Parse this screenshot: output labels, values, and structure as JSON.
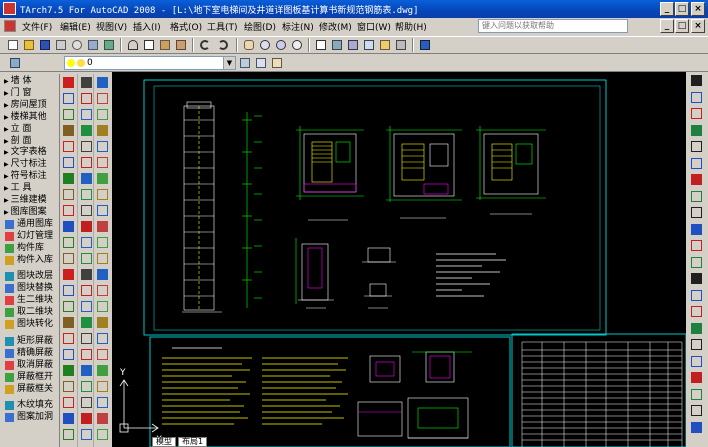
{
  "window": {
    "title": "TArch7.5 For AutoCAD 2008 - [L:\\地下室电梯间及井道详图板基计算书新规范钢筋表.dwg]",
    "buttons": [
      "_",
      "□",
      "×"
    ],
    "inner_buttons": [
      "_",
      "□",
      "×"
    ]
  },
  "menu": {
    "items": [
      "文件(F)",
      "编辑(E)",
      "视图(V)",
      "插入(I)",
      "格式(O)",
      "工具(T)",
      "绘图(D)",
      "标注(N)",
      "修改(M)",
      "窗口(W)",
      "帮助(H)"
    ],
    "help_placeholder": "键入问题以获取帮助"
  },
  "layer": {
    "current": "0"
  },
  "palette": {
    "items": [
      {
        "label": "墙  体",
        "style": "tri"
      },
      {
        "label": "门  窗",
        "style": "tri"
      },
      {
        "label": "房间屋顶",
        "style": "tri"
      },
      {
        "label": "楼梯其他",
        "style": "tri"
      },
      {
        "label": "立  面",
        "style": "tri"
      },
      {
        "label": "剖  面",
        "style": "tri"
      },
      {
        "label": "文字表格",
        "style": "tri"
      },
      {
        "label": "尺寸标注",
        "style": "tri"
      },
      {
        "label": "符号标注",
        "style": "tri"
      },
      {
        "label": "工  具",
        "style": "tri"
      },
      {
        "label": "三维建模",
        "style": "tri"
      },
      {
        "label": "图库图案",
        "style": "tri"
      },
      {
        "label": "通用图库",
        "style": "ico"
      },
      {
        "label": "幻灯管理",
        "style": "ico"
      },
      {
        "label": "构件库",
        "style": "ico"
      },
      {
        "label": "构件入库",
        "style": "ico"
      },
      {
        "label": "",
        "style": "gap"
      },
      {
        "label": "图块改层",
        "style": "ico"
      },
      {
        "label": "图块替换",
        "style": "ico"
      },
      {
        "label": "生二维块",
        "style": "ico"
      },
      {
        "label": "取二维块",
        "style": "ico"
      },
      {
        "label": "图块转化",
        "style": "ico"
      },
      {
        "label": "",
        "style": "gap"
      },
      {
        "label": "矩形屏蔽",
        "style": "ico"
      },
      {
        "label": "精确屏蔽",
        "style": "ico"
      },
      {
        "label": "取消屏蔽",
        "style": "ico"
      },
      {
        "label": "屏蔽框开",
        "style": "ico"
      },
      {
        "label": "屏蔽框关",
        "style": "ico"
      },
      {
        "label": "",
        "style": "gap"
      },
      {
        "label": "木纹填充",
        "style": "ico"
      },
      {
        "label": "图案加洞",
        "style": "ico"
      }
    ]
  },
  "layout_tabs": [
    "模型",
    "布局1"
  ],
  "drawing": {
    "bg": "#000000",
    "frame_color": "#00c8c8",
    "line_colors": [
      "#ffffff",
      "#00ff00",
      "#ffff00",
      "#ff00ff",
      "#00ffff"
    ],
    "ucs_labels": {
      "y": "Y",
      "x": "X"
    }
  }
}
